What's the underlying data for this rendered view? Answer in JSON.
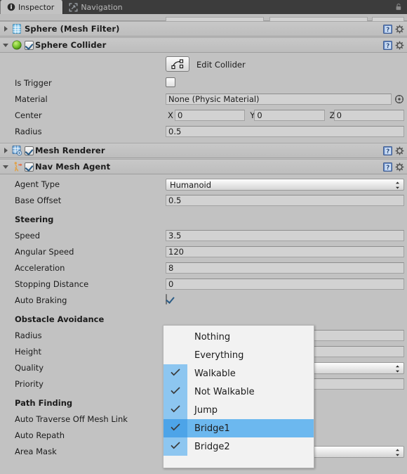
{
  "window": {
    "tabs": [
      {
        "label": "Inspector",
        "icon": "info-icon",
        "active": true
      },
      {
        "label": "Navigation",
        "icon": "navigation-icon",
        "active": false
      }
    ],
    "lock_icon": "lock-icon"
  },
  "components": [
    {
      "name": "mesh-filter",
      "title": "Sphere (Mesh Filter)",
      "expanded": false,
      "icon": "mesh-filter-icon",
      "has_enable_checkbox": false,
      "enabled": false,
      "help_icon": "help-book-icon",
      "menu_icon": "gear-icon"
    },
    {
      "name": "sphere-collider",
      "title": "Sphere Collider",
      "expanded": true,
      "icon": "sphere-collider-icon",
      "has_enable_checkbox": true,
      "enabled": true,
      "help_icon": "help-book-icon",
      "menu_icon": "gear-icon"
    },
    {
      "name": "mesh-renderer",
      "title": "Mesh Renderer",
      "expanded": false,
      "icon": "mesh-renderer-icon",
      "has_enable_checkbox": true,
      "enabled": true,
      "help_icon": "help-book-icon",
      "menu_icon": "gear-icon"
    },
    {
      "name": "nav-mesh-agent",
      "title": "Nav Mesh Agent",
      "expanded": true,
      "icon": "nav-mesh-agent-icon",
      "has_enable_checkbox": true,
      "enabled": true,
      "help_icon": "help-book-icon",
      "menu_icon": "gear-icon"
    }
  ],
  "sphere_collider": {
    "edit_collider": {
      "label": "Edit Collider",
      "icon": "edit-collider-icon"
    },
    "is_trigger": {
      "label": "Is Trigger",
      "value": false
    },
    "material": {
      "label": "Material",
      "value": "None (Physic Material)",
      "picker_icon": "object-picker-icon"
    },
    "center": {
      "label": "Center",
      "x_label": "X",
      "x": "0",
      "y_label": "Y",
      "y": "0",
      "z_label": "Z",
      "z": "0"
    },
    "radius": {
      "label": "Radius",
      "value": "0.5"
    }
  },
  "nav_mesh_agent": {
    "agent_type": {
      "label": "Agent Type",
      "value": "Humanoid"
    },
    "base_offset": {
      "label": "Base Offset",
      "value": "0.5"
    },
    "steering_header": "Steering",
    "speed": {
      "label": "Speed",
      "value": "3.5"
    },
    "angular_speed": {
      "label": "Angular Speed",
      "value": "120"
    },
    "acceleration": {
      "label": "Acceleration",
      "value": "8"
    },
    "stopping_distance": {
      "label": "Stopping Distance",
      "value": "0"
    },
    "auto_braking": {
      "label": "Auto Braking",
      "value": true
    },
    "obstacle_avoidance_header": "Obstacle Avoidance",
    "radius": {
      "label": "Radius",
      "value": ""
    },
    "height": {
      "label": "Height",
      "value": ""
    },
    "quality": {
      "label": "Quality",
      "value": ""
    },
    "priority": {
      "label": "Priority",
      "value": ""
    },
    "path_finding_header": "Path Finding",
    "auto_traverse": {
      "label": "Auto Traverse Off Mesh Link",
      "value": true
    },
    "auto_repath": {
      "label": "Auto Repath",
      "value": true
    },
    "area_mask": {
      "label": "Area Mask",
      "value": ""
    }
  },
  "area_mask_dropdown": {
    "open": true,
    "items": [
      {
        "label": "Nothing",
        "checked": false,
        "selected": false
      },
      {
        "label": "Everything",
        "checked": false,
        "selected": false
      },
      {
        "label": "Walkable",
        "checked": true,
        "selected": false
      },
      {
        "label": "Not Walkable",
        "checked": true,
        "selected": false
      },
      {
        "label": "Jump",
        "checked": true,
        "selected": false
      },
      {
        "label": "Bridge1",
        "checked": true,
        "selected": true
      },
      {
        "label": "Bridge2",
        "checked": true,
        "selected": false
      }
    ]
  },
  "colors": {
    "window_bg": "#c2c2c2",
    "tab_bar_bg": "#3c3c3c",
    "field_bg": "#d2d2d2",
    "menu_bg": "#f2f2f2",
    "menu_check_col": "#8dc6f0",
    "menu_selected": "#6cb8ef",
    "check_mark": "#2b5c86"
  }
}
